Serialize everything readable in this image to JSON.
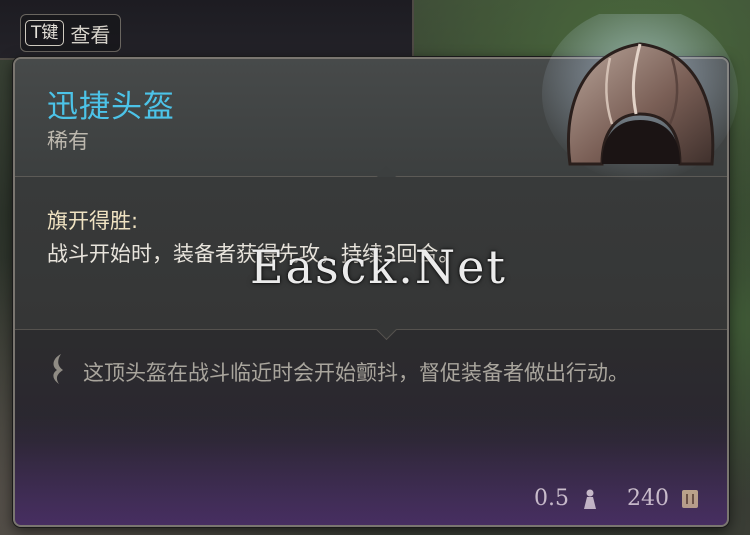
{
  "hotkey": {
    "key": "T键",
    "label": "查看"
  },
  "item": {
    "name": "迅捷头盔",
    "rarity": "稀有",
    "passive_name": "旗开得胜:",
    "passive_desc": "战斗开始时，装备者获得先攻，持续3回合。",
    "lore": "这顶头盔在战斗临近时会开始颤抖，督促装备者做出行动。"
  },
  "stats": {
    "weight": "0.5",
    "value": "240"
  },
  "watermark": "Easck.Net",
  "colors": {
    "item_name": "#4cc3e8",
    "rarity_text": "#bdb8ae",
    "passive_name": "#f0e3c2",
    "lore_text": "#a9a59d",
    "footer_glow": "#5f378c"
  },
  "icons": {
    "item": "helmet-icon",
    "lore": "quill-icon",
    "weight": "weight-icon",
    "value": "gold-coin-icon"
  }
}
